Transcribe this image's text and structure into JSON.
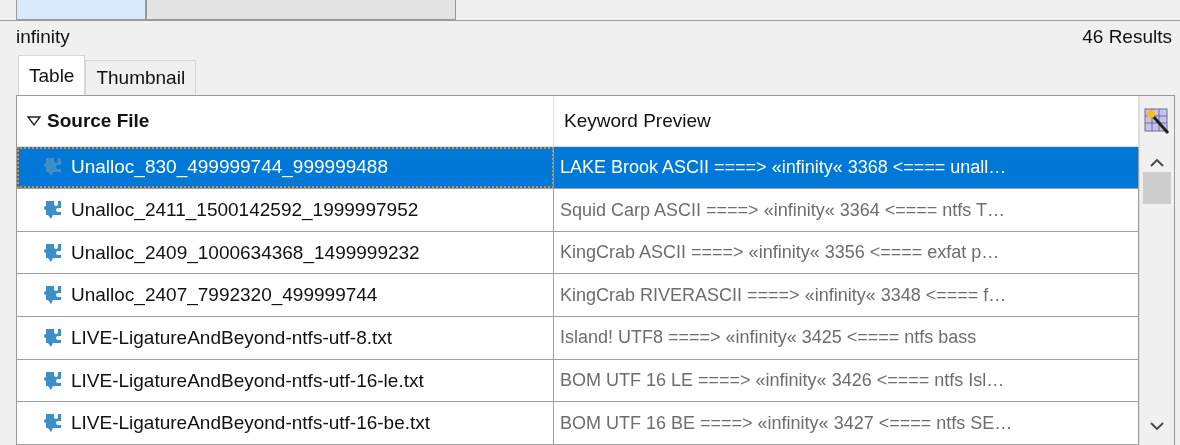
{
  "top_tabs": [
    {
      "selected": true
    },
    {
      "selected": false
    }
  ],
  "query": "infinity",
  "result_count": "46 Results",
  "view_tabs": [
    {
      "label": "Table",
      "selected": true
    },
    {
      "label": "Thumbnail",
      "selected": false
    }
  ],
  "table": {
    "columns": [
      {
        "label": "Source File",
        "sorted": true
      },
      {
        "label": "Keyword Preview",
        "sorted": false
      }
    ],
    "rows": [
      {
        "source_file": "Unalloc_830_499999744_999999488",
        "keyword_preview": "LAKE Brook ASCII ====> «infinity« 3368 <==== unall…",
        "selected": true
      },
      {
        "source_file": "Unalloc_2411_1500142592_1999997952",
        "keyword_preview": "Squid Carp ASCII ====> «infinity« 3364 <==== ntfs T…",
        "selected": false
      },
      {
        "source_file": "Unalloc_2409_1000634368_1499999232",
        "keyword_preview": "KingCrab ASCII ====> «infinity« 3356 <==== exfat p…",
        "selected": false
      },
      {
        "source_file": "Unalloc_2407_7992320_499999744",
        "keyword_preview": "KingCrab RIVERASCII ====> «infinity« 3348 <==== f…",
        "selected": false
      },
      {
        "source_file": "LIVE-LigatureAndBeyond-ntfs-utf-8.txt",
        "keyword_preview": "Island! UTF8 ====> «infinity« 3425 <==== ntfs bass",
        "selected": false
      },
      {
        "source_file": "LIVE-LigatureAndBeyond-ntfs-utf-16-le.txt",
        "keyword_preview": "BOM UTF 16 LE ====> «infinity« 3426 <==== ntfs Isl…",
        "selected": false
      },
      {
        "source_file": "LIVE-LigatureAndBeyond-ntfs-utf-16-be.txt",
        "keyword_preview": "BOM UTF 16 BE ====> «infinity« 3427 <==== ntfs SE…",
        "selected": false
      }
    ]
  }
}
